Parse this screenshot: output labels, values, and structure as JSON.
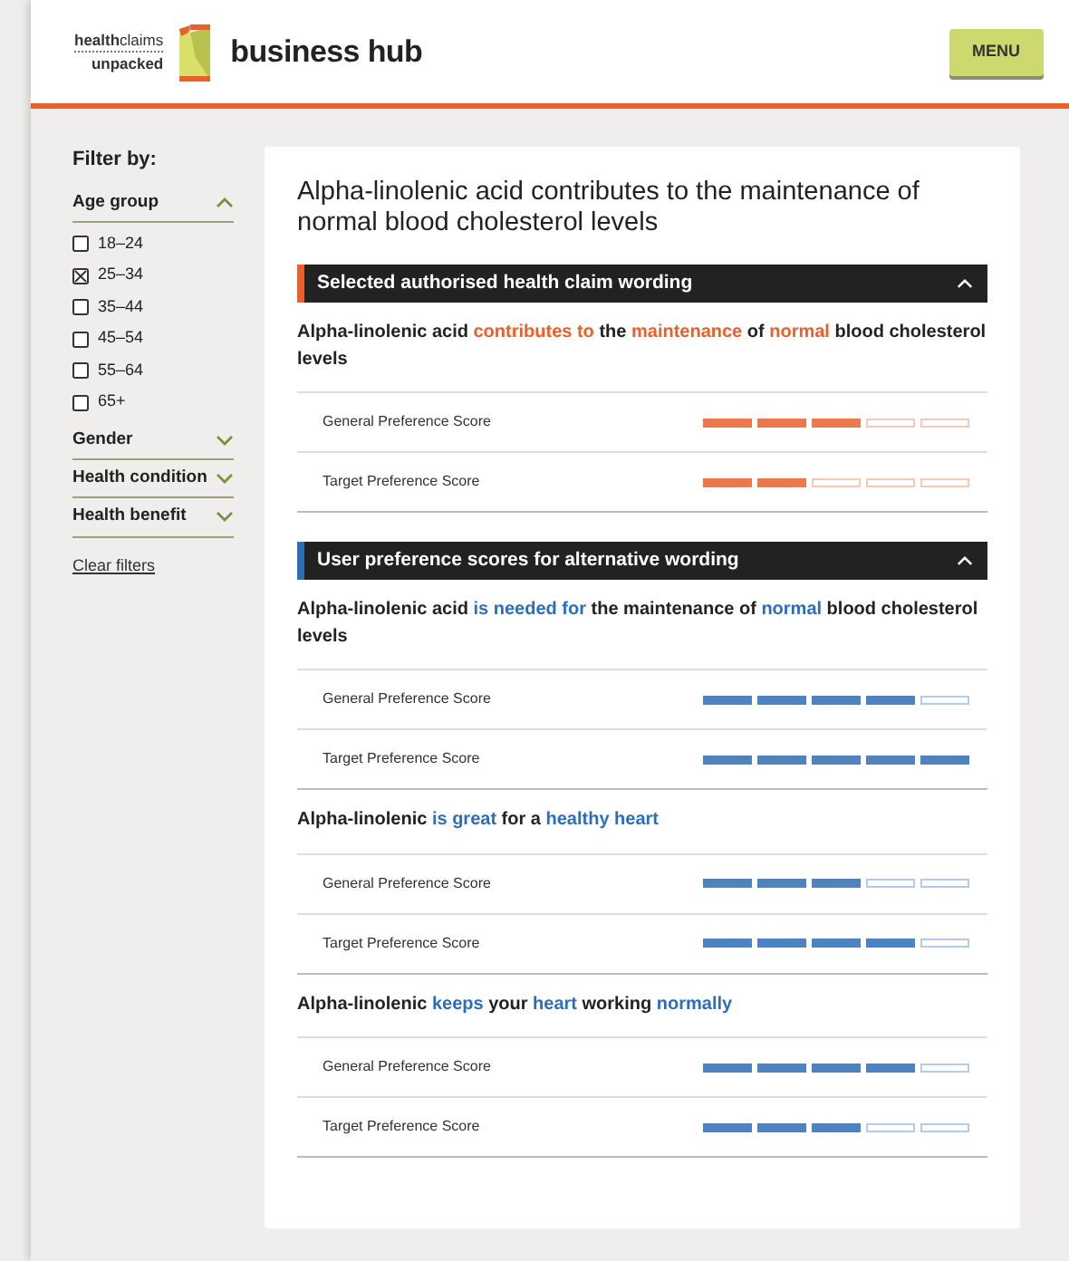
{
  "header": {
    "logo_top": "**health**claims",
    "logo_bottom": "unpacked",
    "brand": "business hub",
    "menu_button": "MENU"
  },
  "sidebar": {
    "title": "Filter by:",
    "groups": [
      {
        "label": "Age group",
        "expanded": true,
        "options": [
          {
            "label": "18–24",
            "checked": false
          },
          {
            "label": "25–34",
            "checked": true
          },
          {
            "label": "35–44",
            "checked": false
          },
          {
            "label": "45–54",
            "checked": false
          },
          {
            "label": "55–64",
            "checked": false
          },
          {
            "label": "65+",
            "checked": false
          }
        ]
      },
      {
        "label": "Gender",
        "expanded": false
      },
      {
        "label": "Health condition",
        "expanded": false
      },
      {
        "label": "Health benefit",
        "expanded": false
      }
    ],
    "clear_link": "Clear filters"
  },
  "main": {
    "title": "Alpha-linolenic acid contributes to the maintenance of normal blood cholesterol levels",
    "sections": [
      {
        "heading": "Selected authorised health claim wording",
        "expanded": true,
        "color": "#e8612c",
        "claims": [
          {
            "wording": "Alpha-linolenic acid **contributes to** the **maintenance** of **normal** blood cholesterol levels",
            "scores": [
              {
                "label": "General Preference Score",
                "stars": 3
              },
              {
                "label": "Target Preference Score",
                "stars": 2
              }
            ]
          }
        ]
      },
      {
        "heading": "User preference scores for alternative wording",
        "expanded": true,
        "color": "#2f6db5",
        "claims": [
          {
            "wording": "Alpha-linolenic acid **is needed for** the maintenance of **normal** blood cholesterol levels",
            "scores": [
              {
                "label": "General Preference Score",
                "stars": 4
              },
              {
                "label": "Target Preference Score",
                "stars": 5
              }
            ]
          },
          {
            "wording": "Alpha-linolenic **is great** for a **healthy heart**",
            "scores": [
              {
                "label": "General Preference Score",
                "stars": 3
              },
              {
                "label": "Target Preference Score",
                "stars": 4
              }
            ]
          },
          {
            "wording": "Alpha-linolenic **keeps** your **heart** working **normally**",
            "scores": [
              {
                "label": "General Preference Score",
                "stars": 4
              },
              {
                "label": "Target Preference Score",
                "stars": 3
              }
            ]
          }
        ]
      }
    ]
  }
}
